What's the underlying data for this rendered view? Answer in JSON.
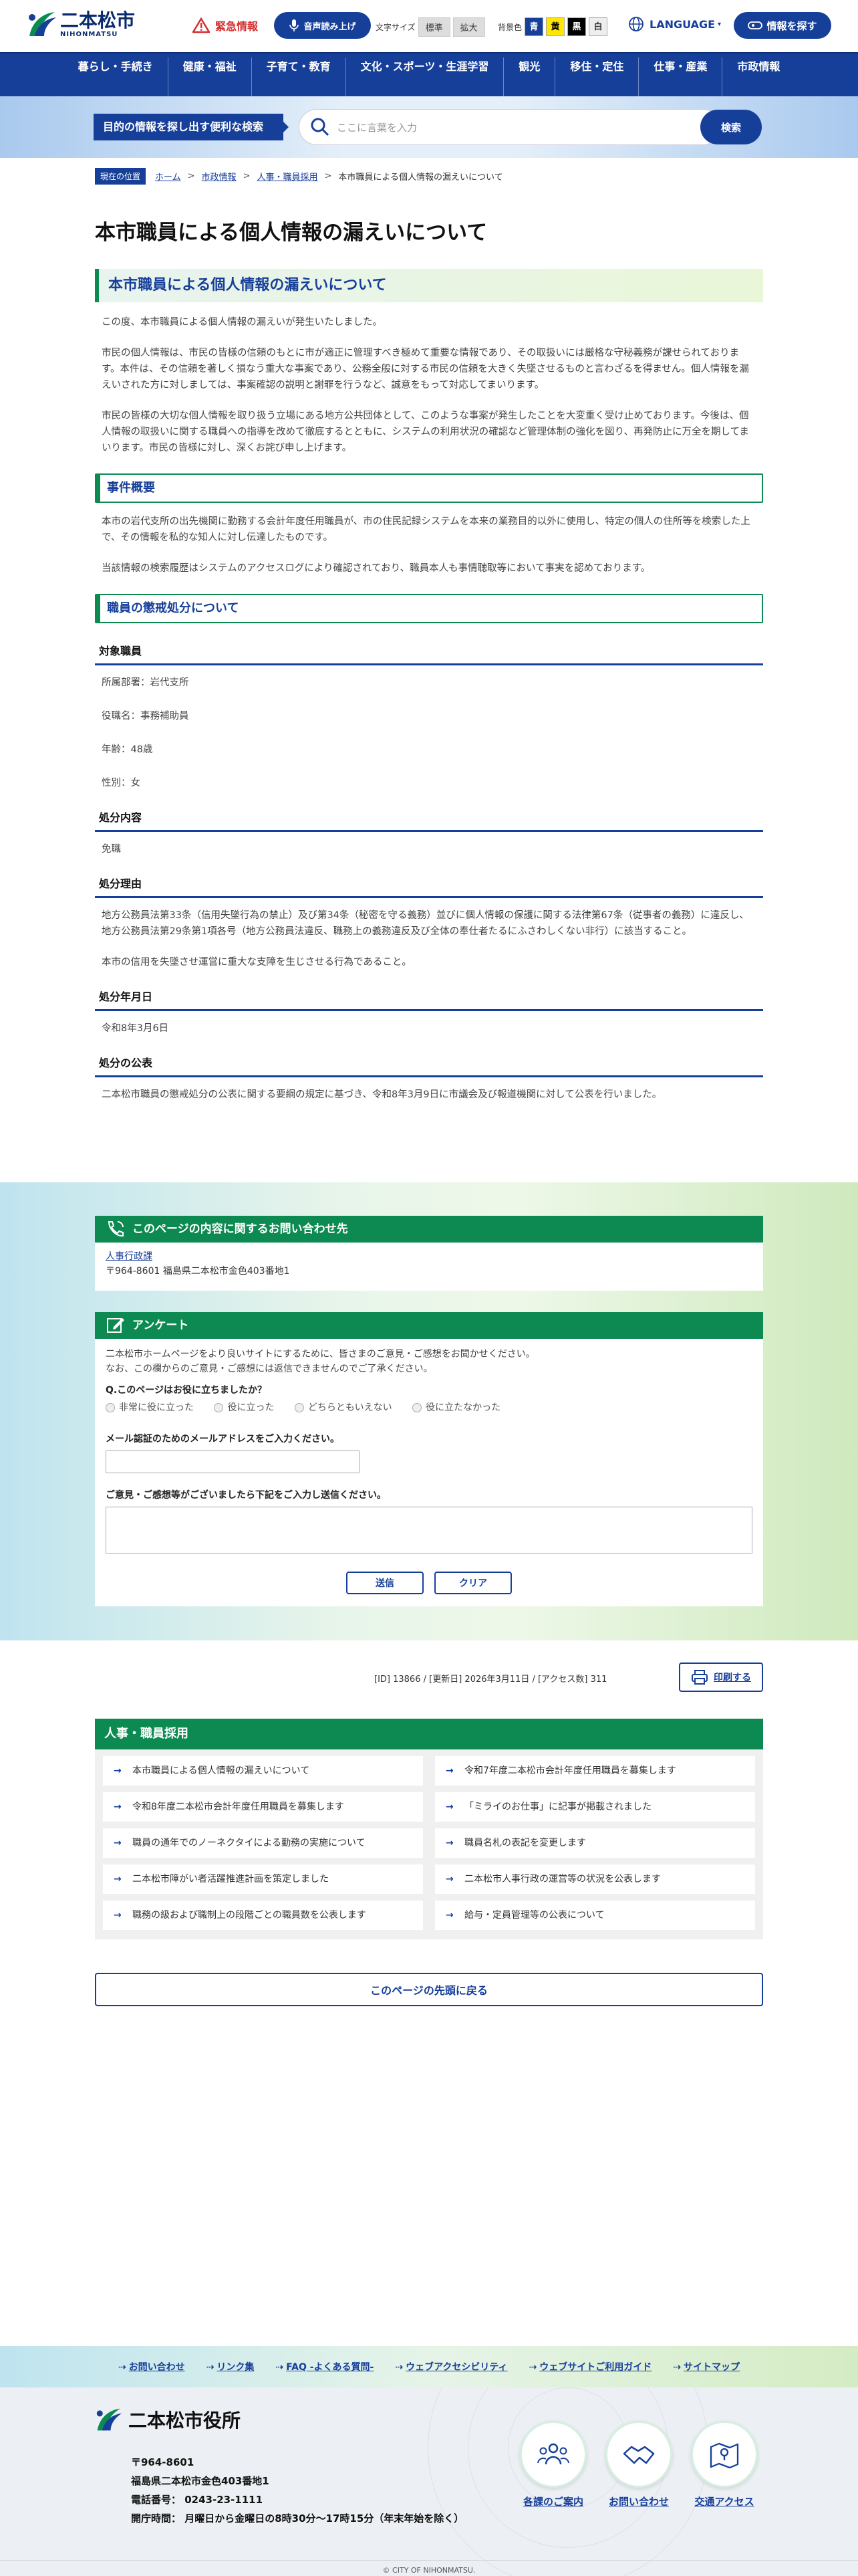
{
  "header": {
    "logo_title": "二本松市",
    "logo_sub": "NIHONMATSU",
    "emergency": "緊急情報",
    "voice": "音声読み上げ",
    "font_size_label": "文字サイズ",
    "font_standard": "標準",
    "font_large": "拡大",
    "bg_label": "背景色",
    "bg_colors": [
      "青",
      "黄",
      "黒",
      "白"
    ],
    "language": "LANGUAGE",
    "find_info": "情報を探す"
  },
  "nav": [
    "暮らし・手続き",
    "健康・福祉",
    "子育て・教育",
    "文化・スポーツ・生涯学習",
    "観光",
    "移住・定住",
    "仕事・産業",
    "市政情報"
  ],
  "search": {
    "label": "目的の情報を探し出す便利な検索",
    "placeholder": "ここに言葉を入力",
    "button": "検索"
  },
  "breadcrumb": {
    "tag": "現在の位置",
    "items": [
      "ホーム",
      "市政情報",
      "人事・職員採用"
    ],
    "current": "本市職員による個人情報の漏えいについて"
  },
  "page_title": "本市職員による個人情報の漏えいについて",
  "article": {
    "heading": "本市職員による個人情報の漏えいについて",
    "intro": "この度、本市職員による個人情報の漏えいが発生いたしました。",
    "para1": "市民の個人情報は、市民の皆様の信頼のもとに市が適正に管理すべき極めて重要な情報であり、その取扱いには厳格な守秘義務が課せられております。本件は、その信頼を著しく損なう重大な事案であり、公務全般に対する市民の信頼を大きく失墜させるものと言わざるを得ません。個人情報を漏えいされた方に対しましては、事案確認の説明と謝罪を行うなど、誠意をもって対応してまいります。",
    "para2": "市民の皆様の大切な個人情報を取り扱う立場にある地方公共団体として、このような事案が発生したことを大変重く受け止めております。今後は、個人情報の取扱いに関する職員への指導を改めて徹底するとともに、システムの利用状況の確認など管理体制の強化を図り、再発防止に万全を期してまいります。市民の皆様に対し、深くお詫び申し上げます。",
    "sec1_title": "事件概要",
    "sec1_p1": "本市の岩代支所の出先機関に勤務する会計年度任用職員が、市の住民記録システムを本来の業務目的以外に使用し、特定の個人の住所等を検索した上で、その情報を私的な知人に対し伝達したものです。",
    "sec1_p2": "当該情報の検索履歴はシステムのアクセスログにより確認されており、職員本人も事情聴取等において事実を認めております。",
    "sec2_title": "職員の懲戒処分について",
    "target_h": "対象職員",
    "target_dept": "所属部署：岩代支所",
    "target_role": "役職名：事務補助員",
    "target_age": "年齢：48歳",
    "target_sex": "性別：女",
    "content_h": "処分内容",
    "content_v": "免職",
    "reason_h": "処分理由",
    "reason_p1": "地方公務員法第33条（信用失墜行為の禁止）及び第34条（秘密を守る義務）並びに個人情報の保護に関する法律第67条（従事者の義務）に違反し、地方公務員法第29条第1項各号（地方公務員法違反、職務上の義務違反及び全体の奉仕者たるにふさわしくない非行）に該当すること。",
    "reason_p2": "本市の信用を失墜させ運営に重大な支障を生じさせる行為であること。",
    "date_h": "処分年月日",
    "date_v": "令和8年3月6日",
    "public_h": "処分の公表",
    "public_v": "二本松市職員の懲戒処分の公表に関する要綱の規定に基づき、令和8年3月9日に市議会及び報道機関に対して公表を行いました。"
  },
  "contact": {
    "title": "このページの内容に関するお問い合わせ先",
    "dept": "人事行政課",
    "address": "〒964-8601 福島県二本松市金色403番地1"
  },
  "survey": {
    "title": "アンケート",
    "intro1": "二本松市ホームページをより良いサイトにするために、皆さまのご意見・ご感想をお聞かせください。",
    "intro2": "なお、この欄からのご意見・ご感想には返信できませんのでご了承ください。",
    "question": "Q.このページはお役に立ちましたか？",
    "options": [
      "非常に役に立った",
      "役に立った",
      "どちらともいえない",
      "役に立たなかった"
    ],
    "email_label": "メール認証のためのメールアドレスをご入力ください。",
    "comment_label": "ご意見・ご感想等がございましたら下記をご入力し送信ください。",
    "submit": "送信",
    "clear": "クリア"
  },
  "meta": {
    "id": "[ID] 13866",
    "updated": "[更新日] 2026年3月11日",
    "access": "[アクセス数] 311",
    "print": "印刷する"
  },
  "related": {
    "title": "人事・職員採用",
    "items": [
      "本市職員による個人情報の漏えいについて",
      "令和7年度二本松市会計年度任用職員を募集します",
      "令和8年度二本松市会計年度任用職員を募集します",
      "「ミライのお仕事」に記事が掲載されました",
      "職員の通年でのノーネクタイによる勤務の実施について",
      "職員名札の表記を変更します",
      "二本松市障がい者活躍推進計画を策定しました",
      "二本松市人事行政の運営等の状況を公表します",
      "職務の級および職制上の段階ごとの職員数を公表します",
      "給与・定員管理等の公表について"
    ]
  },
  "to_top": "このページの先頭に戻る",
  "footer": {
    "links": [
      "お問い合わせ",
      "リンク集",
      "FAQ -よくある質問-",
      "ウェブアクセシビリティ",
      "ウェブサイトご利用ガイド",
      "サイトマップ"
    ],
    "org": "二本松市役所",
    "zip": "〒964-8601",
    "address": "福島県二本松市金色403番地1",
    "tel": "電話番号： 0243-23-1111",
    "hours": "開庁時間： 月曜日から金曜日の8時30分～17時15分（年末年始を除く）",
    "circles": [
      "各課のご案内",
      "お問い合わせ",
      "交通アクセス"
    ],
    "copyright": "© CITY OF NIHONMATSU."
  },
  "colors": {
    "primary": "#163f9a",
    "green": "#0d8a52",
    "alert": "#d32f2f"
  }
}
